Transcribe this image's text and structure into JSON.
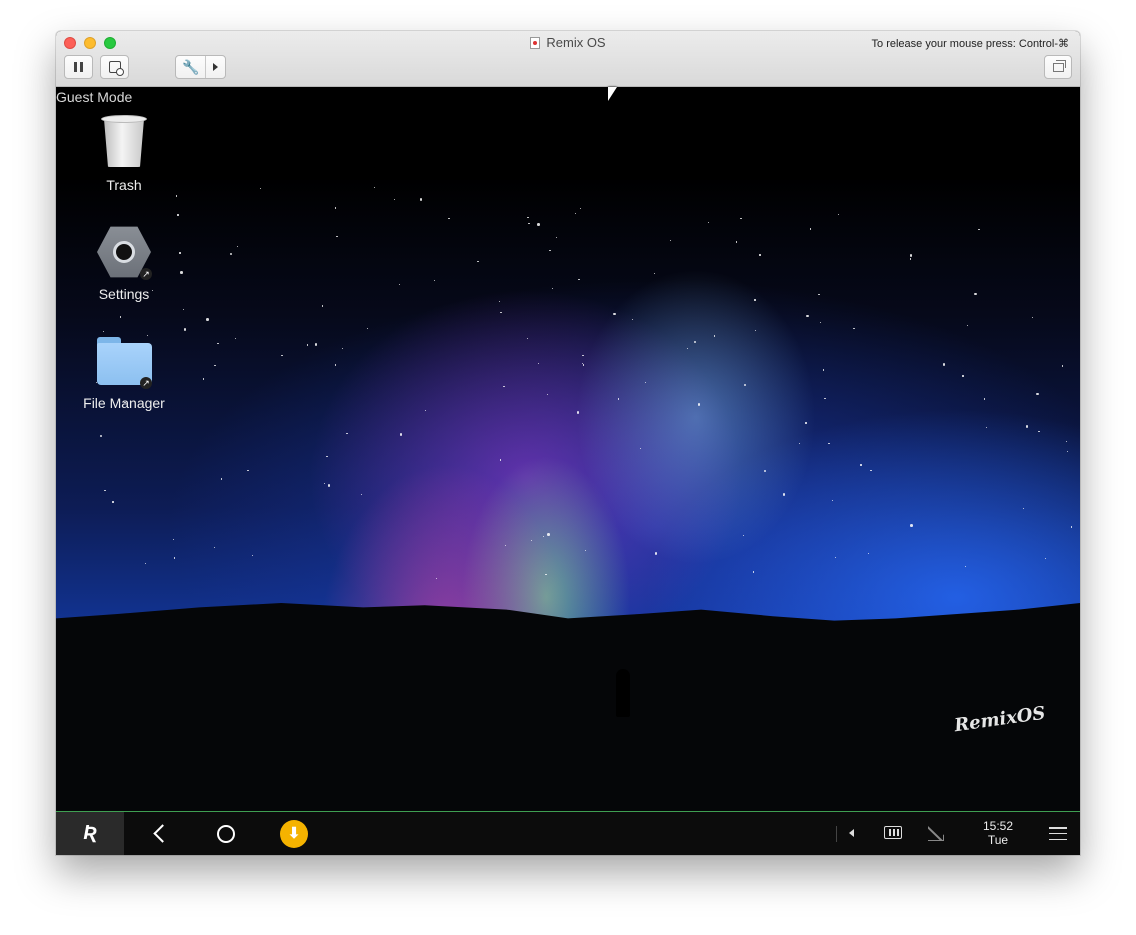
{
  "window": {
    "title": "Remix OS",
    "release_hint": "To release your mouse press: Control-⌘",
    "toolbar": {
      "pause_icon": "pause-icon",
      "snapshot_icon": "snapshot-icon",
      "settings_icon": "wrench-icon",
      "restore_icon": "restore-window-icon"
    }
  },
  "desktop": {
    "mode_label": "Guest Mode",
    "icons": [
      {
        "label": "Trash",
        "icon": "trash-icon"
      },
      {
        "label": "Settings",
        "icon": "settings-nut-icon"
      },
      {
        "label": "File Manager",
        "icon": "folder-icon"
      }
    ],
    "watermark": "RemixOS"
  },
  "taskbar": {
    "start_icon": "remix-start-icon",
    "start_glyph": "Ʀ",
    "clock_time": "15:52",
    "clock_day": "Tue",
    "accent_color": "#3f9f52",
    "download_color": "#f5b300"
  }
}
